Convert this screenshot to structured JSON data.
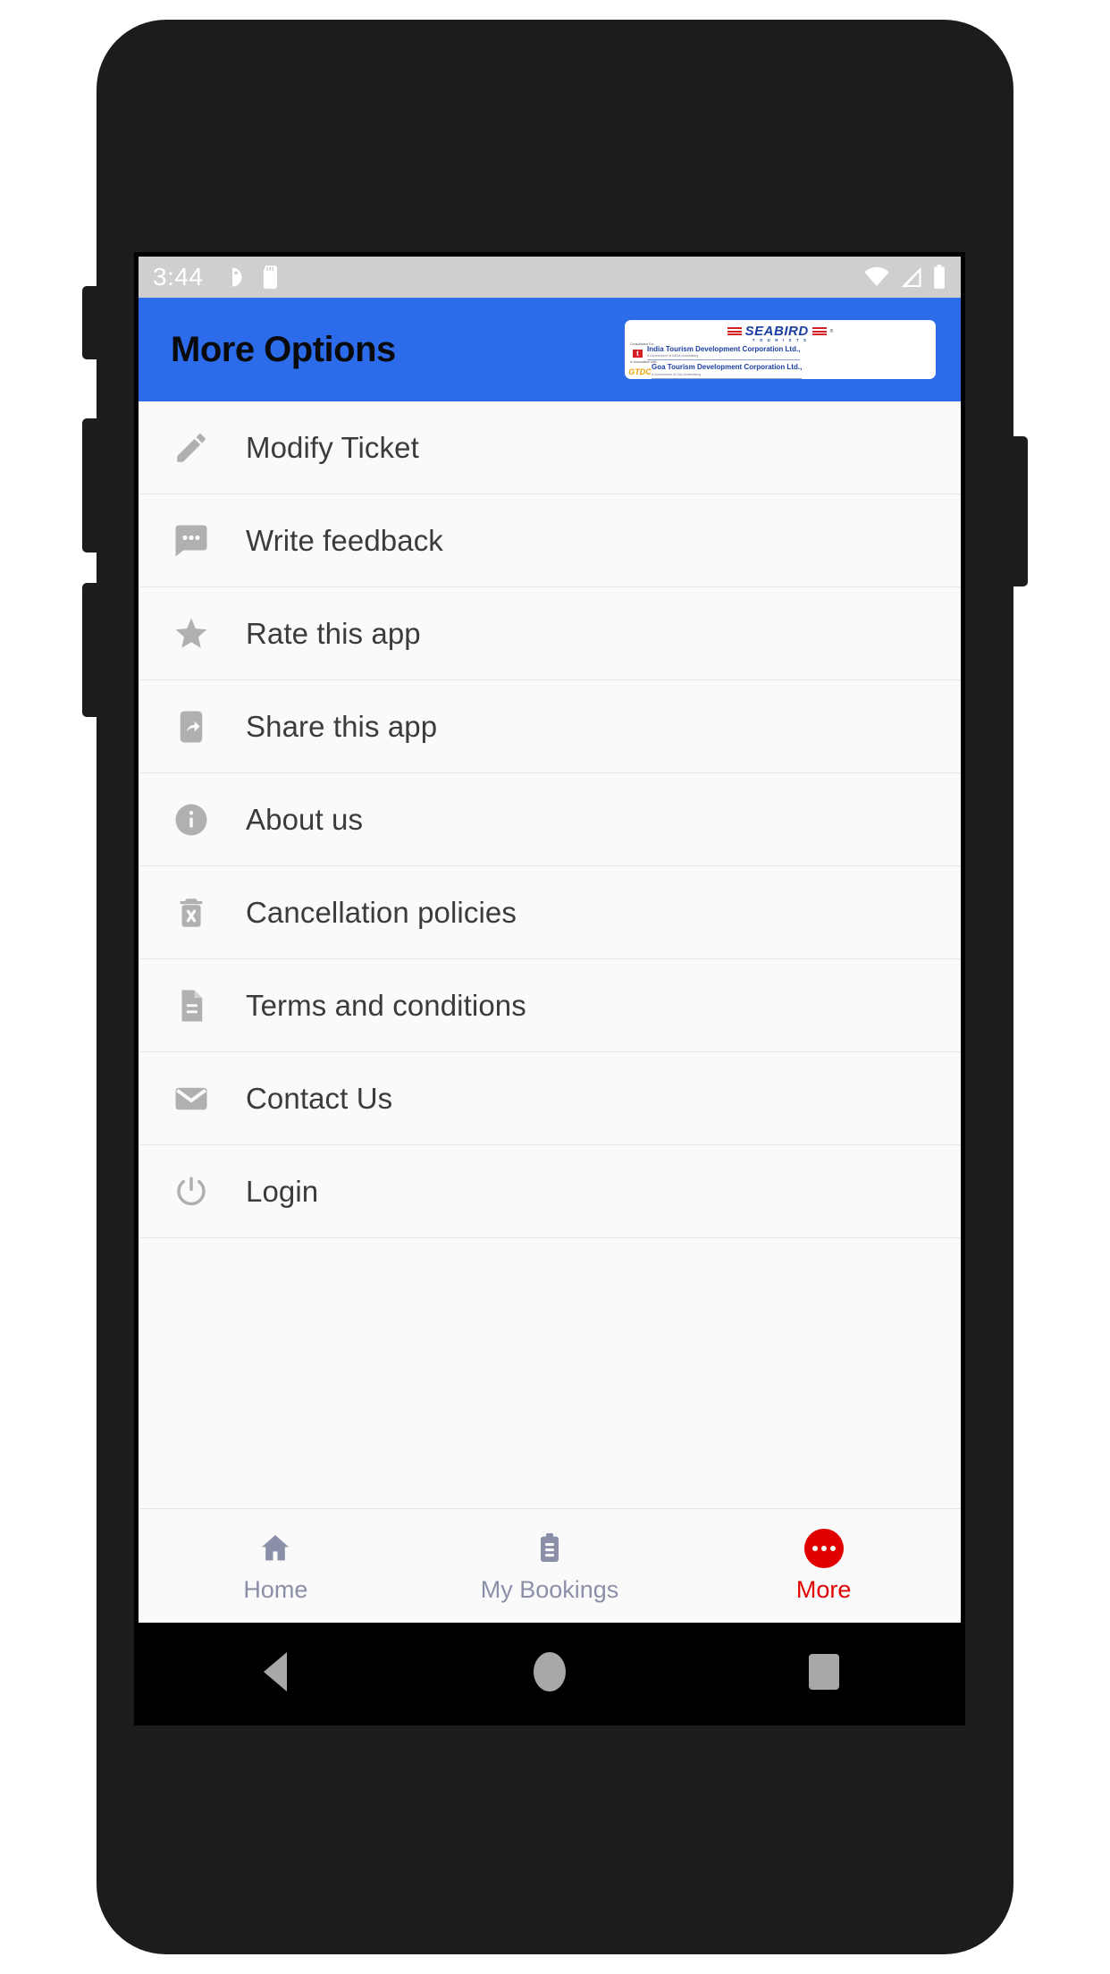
{
  "status_bar": {
    "time": "3:44",
    "left_icons": [
      "do-not-disturb-icon",
      "sd-card-icon"
    ],
    "right_icons": [
      "wifi-icon",
      "cellular-signal-icon",
      "battery-icon"
    ],
    "background_color": "#d0cfcd"
  },
  "app_bar": {
    "title": "More Options",
    "background_color": "#2c6ceb",
    "title_color": "#0a0a0a",
    "logo": {
      "brand": "SEABIRD",
      "brand_sub": "T O U R I S T S",
      "registered_mark": "®",
      "line1_pre": "Consolidator For",
      "line1_org": "India Tourism Development Corporation Ltd.,",
      "line1_sub": "A Government of INDIA undertaking",
      "line1_emblem": "t",
      "line2_pre": "In Association with",
      "line2_org": "Goa Tourism Development Corporation Ltd.,",
      "line2_sub": "A Government of Goa Undertaking",
      "line2_emblem": "GTDC"
    }
  },
  "menu": {
    "items": [
      {
        "label": "Modify Ticket",
        "icon": "pencil-icon"
      },
      {
        "label": "Write feedback",
        "icon": "chat-bubble-icon"
      },
      {
        "label": "Rate this app",
        "icon": "star-icon"
      },
      {
        "label": "Share this app",
        "icon": "phone-share-icon"
      },
      {
        "label": "About us",
        "icon": "info-circle-icon"
      },
      {
        "label": "Cancellation policies",
        "icon": "trash-x-icon"
      },
      {
        "label": "Terms and conditions",
        "icon": "document-icon"
      },
      {
        "label": "Contact Us",
        "icon": "envelope-icon"
      },
      {
        "label": "Login",
        "icon": "power-icon"
      }
    ],
    "icon_color": "#b0b0b0",
    "label_color": "#3b3b3b",
    "divider_color": "#e8e8e8"
  },
  "bottom_nav": {
    "items": [
      {
        "label": "Home",
        "icon": "home-icon",
        "active": false
      },
      {
        "label": "My Bookings",
        "icon": "clipboard-icon",
        "active": false
      },
      {
        "label": "More",
        "icon": "more-dots-icon",
        "active": true
      }
    ],
    "inactive_color": "#8b8fa8",
    "active_color": "#e00000"
  },
  "android_nav": {
    "back": "back-triangle-icon",
    "home": "home-circle-icon",
    "recents": "recents-square-icon"
  }
}
